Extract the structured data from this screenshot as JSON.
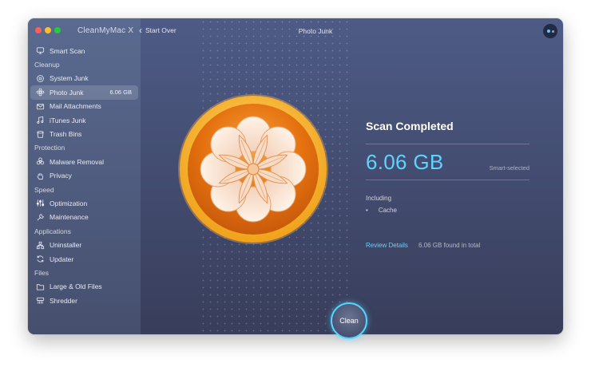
{
  "app": {
    "title": "CleanMyMac X"
  },
  "toolbar": {
    "start_over": "Start Over",
    "page_title": "Photo Junk"
  },
  "sidebar": {
    "top_item": {
      "label": "Smart Scan",
      "icon": "monitor-icon"
    },
    "sections": [
      {
        "title": "Cleanup",
        "items": [
          {
            "label": "System Junk",
            "icon": "gear-icon"
          },
          {
            "label": "Photo Junk",
            "icon": "flower-icon",
            "size": "6.06 GB",
            "active": true
          },
          {
            "label": "Mail Attachments",
            "icon": "mail-icon"
          },
          {
            "label": "iTunes Junk",
            "icon": "music-note-icon"
          },
          {
            "label": "Trash Bins",
            "icon": "trash-icon"
          }
        ]
      },
      {
        "title": "Protection",
        "items": [
          {
            "label": "Malware Removal",
            "icon": "biohazard-icon"
          },
          {
            "label": "Privacy",
            "icon": "hand-icon"
          }
        ]
      },
      {
        "title": "Speed",
        "items": [
          {
            "label": "Optimization",
            "icon": "sliders-icon"
          },
          {
            "label": "Maintenance",
            "icon": "wrench-icon"
          }
        ]
      },
      {
        "title": "Applications",
        "items": [
          {
            "label": "Uninstaller",
            "icon": "uninstaller-icon"
          },
          {
            "label": "Updater",
            "icon": "refresh-icon"
          }
        ]
      },
      {
        "title": "Files",
        "items": [
          {
            "label": "Large & Old Files",
            "icon": "folder-icon"
          },
          {
            "label": "Shredder",
            "icon": "shredder-icon"
          }
        ]
      }
    ]
  },
  "result": {
    "title": "Scan Completed",
    "size": "6.06 GB",
    "smart_selected": "Smart-selected",
    "including_label": "Including",
    "bullet": "•",
    "items": [
      "Cache"
    ],
    "review_link": "Review Details",
    "found_text": "6.06 GB found in total"
  },
  "actions": {
    "clean": "Clean"
  },
  "colors": {
    "accent": "#5ed3ff",
    "icon_orange": "#f28a1c",
    "bg": "#424b6e"
  }
}
